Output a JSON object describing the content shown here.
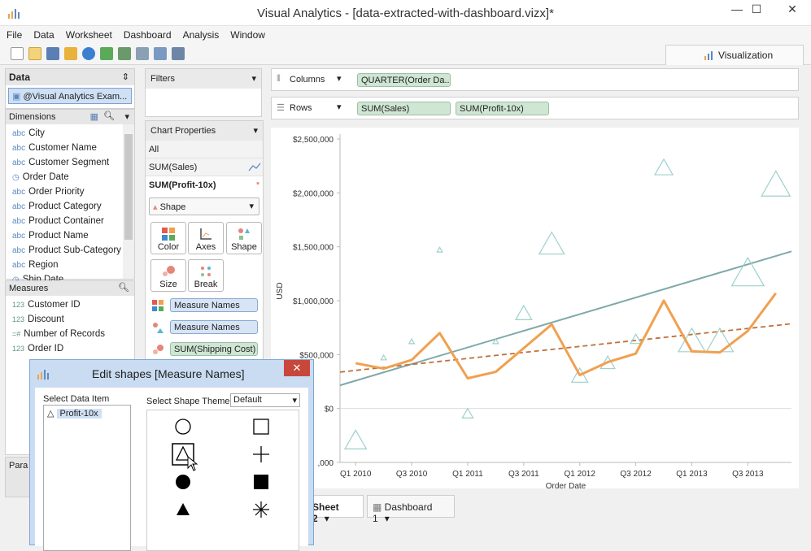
{
  "window": {
    "title": "Visual Analytics - [data-extracted-with-dashboard.vizx]*",
    "minimize": "—",
    "maximize": "☐",
    "close": "✕"
  },
  "menu": [
    "File",
    "Data",
    "Worksheet",
    "Dashboard",
    "Analysis",
    "Window"
  ],
  "viz_tab": "Visualization",
  "data_panel": {
    "title": "Data",
    "source": "@Visual Analytics Exam...",
    "dimensions_title": "Dimensions",
    "dimensions": [
      {
        "type": "abc",
        "label": "City"
      },
      {
        "type": "abc",
        "label": "Customer Name"
      },
      {
        "type": "abc",
        "label": "Customer Segment"
      },
      {
        "type": "date",
        "label": "Order Date"
      },
      {
        "type": "abc",
        "label": "Order Priority"
      },
      {
        "type": "abc",
        "label": "Product Category"
      },
      {
        "type": "abc",
        "label": "Product Container"
      },
      {
        "type": "abc",
        "label": "Product Name"
      },
      {
        "type": "abc",
        "label": "Product Sub-Category"
      },
      {
        "type": "abc",
        "label": "Region"
      },
      {
        "type": "date",
        "label": "Ship Date"
      }
    ],
    "measures_title": "Measures",
    "measures": [
      {
        "type": "123",
        "label": "Customer ID"
      },
      {
        "type": "123",
        "label": "Discount"
      },
      {
        "type": "calc",
        "label": "Number of Records"
      },
      {
        "type": "123",
        "label": "Order ID"
      }
    ],
    "params_title": "Para"
  },
  "filters": {
    "title": "Filters"
  },
  "chart_props": {
    "title": "Chart Properties",
    "tabs": [
      "All",
      "SUM(Sales)",
      "SUM(Profit-10x)"
    ],
    "mark_type": "Shape",
    "buttons": [
      "Color",
      "Axes",
      "Shape",
      "Size",
      "Break"
    ],
    "encodings": [
      {
        "icon": "color",
        "label": "Measure Names"
      },
      {
        "icon": "shape",
        "label": "Measure Names"
      },
      {
        "icon": "size",
        "label": "SUM(Shipping Cost)"
      }
    ]
  },
  "shelves": {
    "columns_label": "Columns",
    "columns_pill": "QUARTER(Order Da...",
    "rows_label": "Rows",
    "rows_pills": [
      "SUM(Sales)",
      "SUM(Profit-10x)"
    ]
  },
  "chart_data": {
    "type": "line",
    "ylabel": "USD",
    "xlabel": "Order Date",
    "y_ticks": [
      "$2,500,000",
      "$2,000,000",
      "$1,500,000",
      "$1,000,000",
      "$500,000",
      "$0",
      ",000"
    ],
    "x_ticks": [
      "Q1 2010",
      "Q3 2010",
      "Q1 2011",
      "Q3 2011",
      "Q1 2012",
      "Q3 2012",
      "Q1 2013",
      "Q3 2013"
    ],
    "ylim": [
      -500000,
      2500000
    ],
    "colors": {
      "sales": "#f0a050",
      "trend_sales": "#c07038",
      "profit": "#9fd0cc",
      "trend_profit": "#7fa9aa"
    },
    "series": [
      {
        "name": "SUM(Sales)",
        "x": [
          0,
          1,
          2,
          3,
          4,
          5,
          6,
          7,
          8,
          9,
          10,
          11,
          12,
          13,
          14,
          15
        ],
        "values": [
          420000,
          370000,
          450000,
          700000,
          280000,
          340000,
          560000,
          780000,
          310000,
          430000,
          510000,
          1000000,
          530000,
          520000,
          720000,
          1070000
        ]
      },
      {
        "name": "Profit-10x",
        "x": [
          0,
          1,
          2,
          3,
          4,
          5,
          6,
          7,
          8,
          9,
          10,
          11,
          12,
          13,
          14,
          15
        ],
        "values": [
          -300000,
          470000,
          620000,
          1470000,
          -50000,
          620000,
          880000,
          1520000,
          300000,
          420000,
          640000,
          2230000,
          620000,
          620000,
          1250000,
          2070000
        ],
        "sizes": [
          1.2,
          0.3,
          0.3,
          0.3,
          0.6,
          0.3,
          0.9,
          1.4,
          0.9,
          0.8,
          0.6,
          1.0,
          1.5,
          1.5,
          1.8,
          1.6
        ]
      }
    ]
  },
  "sheet_tabs": [
    "Sheet 2",
    "Dashboard 1"
  ],
  "dialog": {
    "title": "Edit shapes [Measure Names]",
    "select_item_label": "Select Data Item",
    "items": [
      "Profit-10x"
    ],
    "theme_label": "Select Shape Theme:",
    "theme_value": "Default",
    "shapes": [
      "circle",
      "square",
      "triangle-in-square",
      "plus",
      "filled-circle",
      "filled-square",
      "filled-triangle",
      "asterisk"
    ]
  }
}
